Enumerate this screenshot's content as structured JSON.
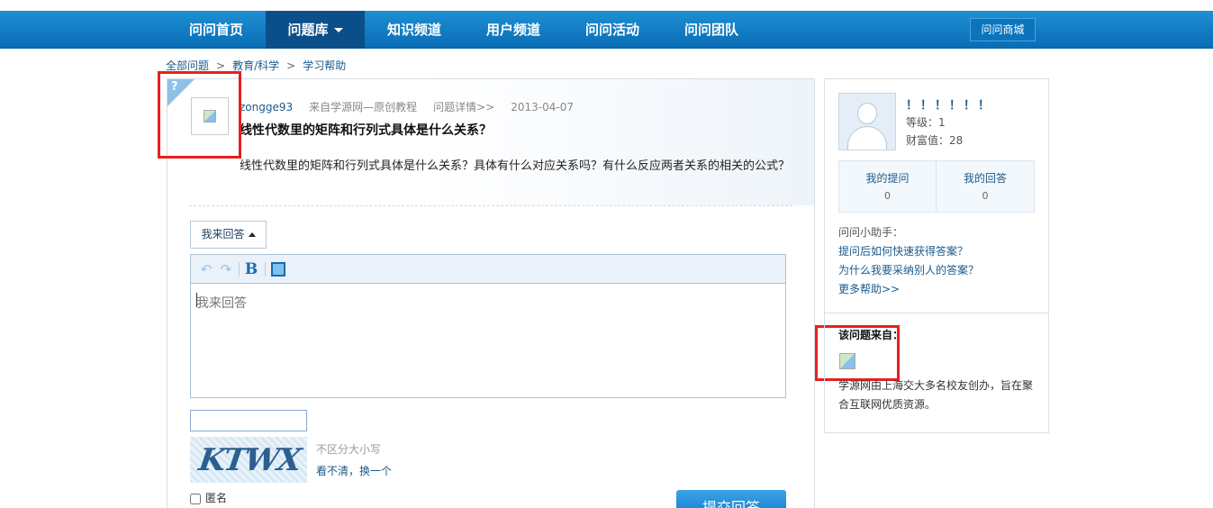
{
  "nav": {
    "items": [
      "问问首页",
      "问题库",
      "知识频道",
      "用户频道",
      "问问活动",
      "问问团队"
    ],
    "active_index": 1,
    "mall": "问问商城"
  },
  "breadcrumb": [
    "全部问题",
    "教育/科学",
    "学习帮助"
  ],
  "question": {
    "corner_mark": "?",
    "user": "zongge93",
    "source": "来自学源网—原创教程",
    "detail_link": "问题详情>>",
    "date": "2013-04-07",
    "title": "线性代数里的矩阵和行列式具体是什么关系？",
    "body": "线性代数里的矩阵和行列式具体是什么关系？具体有什么对应关系吗？有什么反应两者关系的相关的公式？"
  },
  "answer": {
    "tab_label": "我来回答",
    "placeholder": "我来回答",
    "toolbar": [
      "undo-icon",
      "redo-icon",
      "bold-icon",
      "image-icon"
    ],
    "captcha_text": "KTWX",
    "captcha_hint": "不区分大小写",
    "captcha_change": "看不清，换一个",
    "anonymous_label": "匿名",
    "submit_label": "提交回答"
  },
  "sidebar": {
    "name": "！！！！！！",
    "level": "等级：1",
    "wealth": "财富值：28",
    "stats": [
      {
        "label": "我的提问",
        "value": "0"
      },
      {
        "label": "我的回答",
        "value": "0"
      }
    ],
    "helper_title": "问问小助手：",
    "helper_links": [
      "提问后如何快速获得答案？",
      "为什么我要采纳别人的答案？",
      "更多帮助>>"
    ],
    "source_title": "该问题来自：",
    "source_desc": "学源网由上海交大多名校友创办，旨在聚合互联网优质资源。"
  },
  "colors": {
    "nav_bg": "#0a6db6",
    "nav_active": "#0a4f8a",
    "link": "#1a5a8c",
    "annotation": "#e8201e",
    "submit": "#1076c5"
  }
}
